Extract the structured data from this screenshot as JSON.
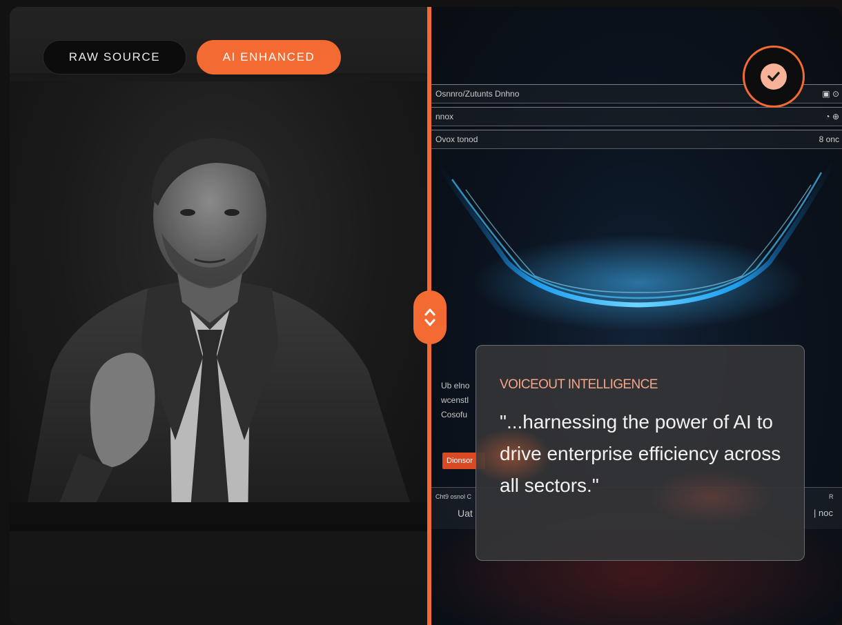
{
  "toggle": {
    "raw_label": "RAW SOURCE",
    "ai_label": "AI ENHANCED",
    "active": "AI ENHANCED"
  },
  "colors": {
    "accent": "#f36a32",
    "badge_fill": "#f7b298",
    "quote_label": "#f5a58a"
  },
  "icons": {
    "divider_handle": "chevron-up-down-icon",
    "status": "check-icon"
  },
  "enhanced_screen": {
    "rows": [
      {
        "left": "Osnnro/Zutunts Dnhno",
        "right": "▣ ⊙"
      },
      {
        "left": "nnox",
        "right": "◔ ⊕"
      },
      {
        "left": "Ovox tonod",
        "right": "8 onc"
      }
    ],
    "side_text": [
      "Ub elno",
      "wcenstl",
      "Cosofu"
    ],
    "tag": "Dionsor",
    "strip_left_small": "Cht9 osnol C",
    "strip_left": "Uat",
    "strip_right_small": "R",
    "strip_right": "| noc"
  },
  "quote": {
    "label": "VOICEOUT INTELLIGENCE",
    "text": "\"...harnessing the power of AI to drive enterprise efficiency across all sectors.\""
  }
}
